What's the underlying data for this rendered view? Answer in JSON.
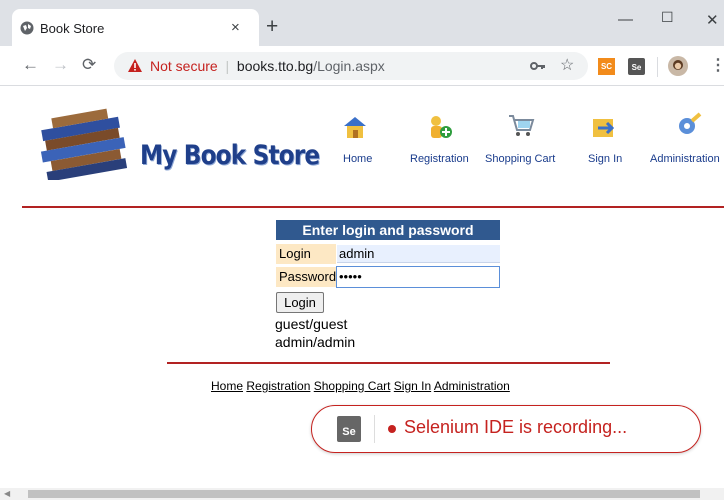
{
  "browser": {
    "tab_title": "Book Store",
    "tab_close": "×",
    "new_tab": "+",
    "minimize": "—",
    "maximize": "☐",
    "close": "✕",
    "security_label": "Not secure",
    "url_host": "books.tto.bg",
    "url_path": "/Login.aspx",
    "ext_sc": "SC",
    "ext_se": "Se"
  },
  "site": {
    "logo_text": "My Book Store",
    "nav": [
      {
        "label": "Home",
        "icon": "house-icon"
      },
      {
        "label": "Registration",
        "icon": "registration-icon"
      },
      {
        "label": "Shopping Cart",
        "icon": "shopping-cart-icon"
      },
      {
        "label": "Sign In",
        "icon": "sign-in-icon"
      },
      {
        "label": "Administration",
        "icon": "administration-icon"
      }
    ]
  },
  "login": {
    "header": "Enter login and password",
    "login_label": "Login",
    "login_value": "admin",
    "password_label": "Password",
    "password_value": "•••••",
    "button": "Login",
    "hint1": "guest/guest",
    "hint2": "admin/admin"
  },
  "footer": {
    "links": [
      "Home",
      "Registration",
      "Shopping Cart",
      "Sign In",
      "Administration"
    ]
  },
  "selenium": {
    "logo": "Se",
    "message": "Selenium IDE is recording..."
  },
  "colors": {
    "accent_red": "#b22222",
    "header_blue": "#30598f",
    "label_bg": "#fde8c4"
  }
}
